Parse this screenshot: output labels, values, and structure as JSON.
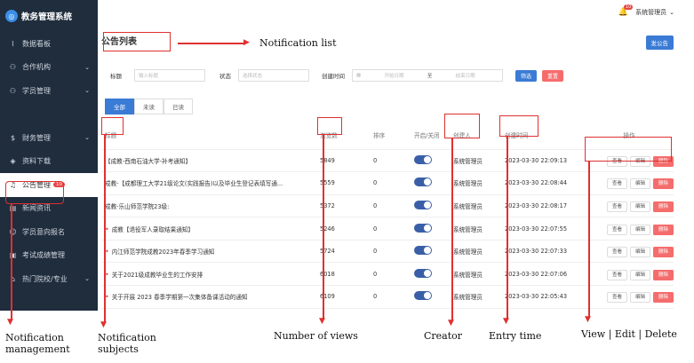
{
  "app": {
    "title": "教务管理系统",
    "user": "系统管理员",
    "bell_count": "10"
  },
  "sidebar": {
    "items": [
      {
        "label": "数据看板",
        "icon": "chart-icon",
        "chev": ""
      },
      {
        "label": "合作机构",
        "icon": "person-icon",
        "chev": "⌄"
      },
      {
        "label": "学员管理",
        "icon": "people-icon",
        "chev": "⌄"
      },
      {
        "label": "",
        "icon": "blank-icon",
        "chev": ""
      },
      {
        "label": "财务管理",
        "icon": "coin-icon",
        "chev": "⌄"
      },
      {
        "label": "资料下载",
        "icon": "layers-icon",
        "chev": ""
      },
      {
        "label": "公告管理",
        "icon": "bell-icon",
        "chev": "",
        "badge": "10"
      },
      {
        "label": "新闻资讯",
        "icon": "news-icon",
        "chev": ""
      },
      {
        "label": "学员意向报名",
        "icon": "user-icon",
        "chev": ""
      },
      {
        "label": "考试成绩管理",
        "icon": "grade-icon",
        "chev": ""
      },
      {
        "label": "热门院校/专业",
        "icon": "school-icon",
        "chev": "⌄"
      }
    ]
  },
  "page": {
    "title": "公告列表",
    "add_button": "发公告"
  },
  "filter": {
    "title_label": "标题",
    "title_placeholder": "输入标题",
    "status_label": "状态",
    "status_placeholder": "选择状态",
    "time_label": "创建时间",
    "start_placeholder": "开始日期",
    "range_sep": "至",
    "end_placeholder": "结束日期",
    "search_btn": "筛选",
    "reset_btn": "重置"
  },
  "tabs": [
    "全部",
    "未读",
    "已读"
  ],
  "table": {
    "headers": [
      "标题",
      "浏览数",
      "排序",
      "开启/关闭",
      "创建人",
      "创建时间",
      "操作"
    ],
    "rows": [
      {
        "dot": false,
        "title": "【成教-西南石油大学-补考通知】",
        "views": "5849",
        "sort": "0",
        "creator": "系统管理员",
        "time": "2023-03-30 22:09:13"
      },
      {
        "dot": false,
        "title": "成教-【成都理工大学21级论文(实践报告)以及毕业生登记表填写通...",
        "views": "5559",
        "sort": "0",
        "creator": "系统管理员",
        "time": "2023-03-30 22:08:44"
      },
      {
        "dot": false,
        "title": "成教-乐山师范学院23级:",
        "views": "5372",
        "sort": "0",
        "creator": "系统管理员",
        "time": "2023-03-30 22:08:17"
      },
      {
        "dot": true,
        "title": "成教【退役军人录取结果通知】",
        "views": "5246",
        "sort": "0",
        "creator": "系统管理员",
        "time": "2023-03-30 22:07:55"
      },
      {
        "dot": true,
        "title": "内江师范学院成教2023年春季学习通知",
        "views": "5724",
        "sort": "0",
        "creator": "系统管理员",
        "time": "2023-03-30 22:07:33"
      },
      {
        "dot": true,
        "title": "关于2021级成教毕业生的工作安排",
        "views": "6018",
        "sort": "0",
        "creator": "系统管理员",
        "time": "2023-03-30 22:07:06"
      },
      {
        "dot": true,
        "title": "关于开展 2023 春季学期第一次集体备课活动的通知",
        "views": "6109",
        "sort": "0",
        "creator": "系统管理员",
        "time": "2023-03-30 22:05:43"
      }
    ],
    "ops": {
      "view": "查看",
      "edit": "编辑",
      "delete": "删除"
    }
  },
  "annotations": {
    "notification_list": "Notification list",
    "notification_management": "Notification\nmanagement",
    "notification_subjects": "Notification\nsubjects",
    "number_of_views": "Number of views",
    "creator": "Creator",
    "entry_time": "Entry time",
    "operations": "View | Edit | Delete"
  }
}
